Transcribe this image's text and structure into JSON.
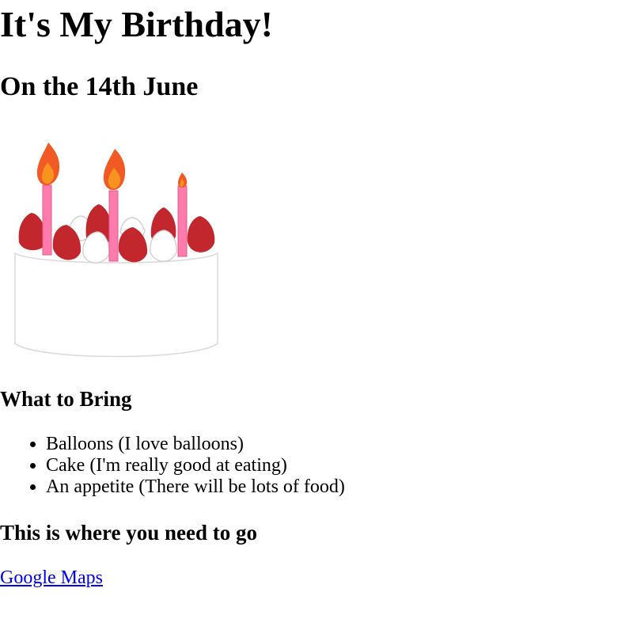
{
  "page": {
    "title": "It's My Birthday!",
    "subtitle": "On the 14th June"
  },
  "image": {
    "icon": "birthday-cake-icon"
  },
  "bring": {
    "heading": "What to Bring",
    "items": [
      "Balloons (I love balloons)",
      "Cake (I'm really good at eating)",
      "An appetite (There will be lots of food)"
    ]
  },
  "directions": {
    "heading": "This is where you need to go",
    "link_text": "Google Maps"
  },
  "colors": {
    "link": "#0000ee",
    "candle": "#ff7bac",
    "strawberry": "#c1272d",
    "flame": "#f15a24",
    "flame_inner": "#f7931e"
  }
}
